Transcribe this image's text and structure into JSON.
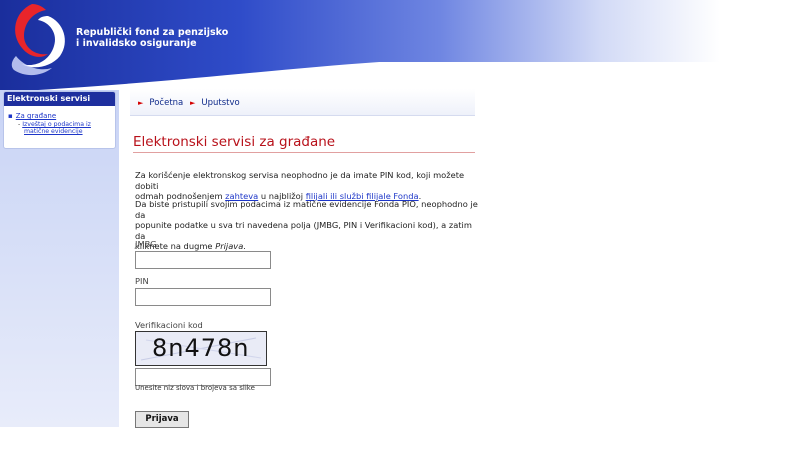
{
  "header": {
    "org_name_line1": "Republički fond za penzijsko",
    "org_name_line2": "i invalidsko osiguranje"
  },
  "sidebar": {
    "title": "Elektronski servisi",
    "items": [
      {
        "label": "Za građane",
        "subitems": [
          {
            "label_line1": "Izveštaj o podacima iz",
            "label_line2": "matične evidencije"
          }
        ]
      }
    ]
  },
  "breadcrumb": {
    "items": [
      {
        "label": "Početna"
      },
      {
        "label": "Uputstvo"
      }
    ]
  },
  "main": {
    "title": "Elektronski servisi za građane",
    "intro": {
      "line1": "Za korišćenje elektronskog servisa neophodno je da imate PIN kod, koji možete dobiti",
      "line2_before": "odmah podnošenjem",
      "link_request": "zahteva",
      "line2_middle": "u najbližoj",
      "link_branches": "filijali ili službi filijale Fonda",
      "line2_end": "."
    },
    "instructions": {
      "line1": "Da biste pristupili svojim podacima iz matične evidencije Fonda PIO, neophodno je da",
      "line2": "popunite podatke u sva tri navedena polja (JMBG, PIN i Verifikacioni kod), a zatim da",
      "line3_before": "kliknete na dugme",
      "line3_em": "Prijava",
      "line3_end": "."
    },
    "form": {
      "jmbg_label": "JMBG",
      "jmbg_value": "",
      "pin_label": "PIN",
      "pin_value": "",
      "verification_label": "Verifikacioni kod",
      "captcha_text": "8n478n",
      "verification_value": "",
      "verification_hint": "Unesite niz slova i brojeva sa slike",
      "submit_label": "Prijava"
    }
  },
  "colors": {
    "header_dark": "#1a2e9c",
    "title_red": "#b8111a",
    "link_blue": "#1d36c8",
    "sidebar_title_bg": "#1e2f9e"
  }
}
